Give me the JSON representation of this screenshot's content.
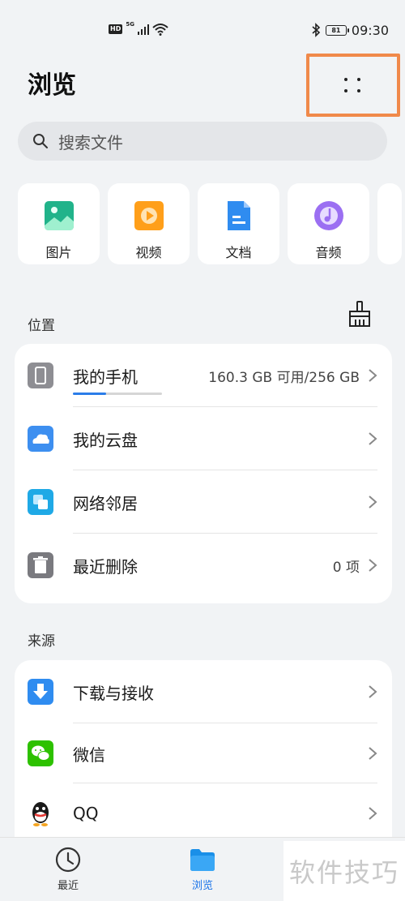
{
  "status_bar": {
    "hd": "HD",
    "network": "5G",
    "battery": "81",
    "time": "09:30"
  },
  "header": {
    "title": "浏览"
  },
  "search": {
    "placeholder": "搜索文件"
  },
  "categories": [
    {
      "label": "图片",
      "icon": "image-icon",
      "color": "#21b38a"
    },
    {
      "label": "视频",
      "icon": "video-icon",
      "color": "#ff9f1a"
    },
    {
      "label": "文档",
      "icon": "document-icon",
      "color": "#2f8cf0"
    },
    {
      "label": "音频",
      "icon": "audio-icon",
      "color": "#9b6ff2"
    }
  ],
  "locations": {
    "label": "位置",
    "items": [
      {
        "title": "我的手机",
        "value": "160.3 GB 可用/256 GB",
        "icon": "phone-icon",
        "storage_used_fraction": 0.37
      },
      {
        "title": "我的云盘",
        "value": "",
        "icon": "cloud-icon"
      },
      {
        "title": "网络邻居",
        "value": "",
        "icon": "network-icon"
      },
      {
        "title": "最近删除",
        "value": "0 项",
        "icon": "trash-icon"
      }
    ]
  },
  "sources": {
    "label": "来源",
    "items": [
      {
        "title": "下载与接收",
        "icon": "download-icon"
      },
      {
        "title": "微信",
        "icon": "wechat-icon"
      },
      {
        "title": "QQ",
        "icon": "qq-icon"
      }
    ]
  },
  "bottom_nav": {
    "recent": "最近",
    "browse": "浏览"
  },
  "watermark": "软件技巧",
  "colors": {
    "accent": "#2b7de9",
    "highlight_border": "#f0894a",
    "active_nav": "#1a73e8"
  }
}
